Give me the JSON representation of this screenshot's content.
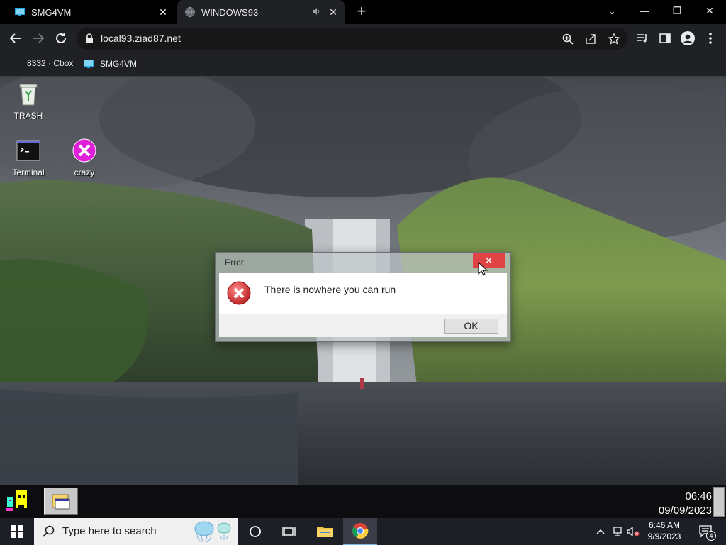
{
  "browser": {
    "tabs": [
      {
        "title": "SMG4VM",
        "active": false
      },
      {
        "title": "WINDOWS93",
        "active": true
      }
    ],
    "url": "local93.ziad87.net",
    "bookmarks": [
      {
        "label": "8332 · Cbox"
      },
      {
        "label": "SMG4VM"
      }
    ]
  },
  "desktop": {
    "icons": [
      {
        "label": "TRASH",
        "icon": "recycle-bin-icon"
      },
      {
        "label": "Terminal",
        "icon": "terminal-icon"
      },
      {
        "label": "crazy",
        "icon": "crazy-x-icon"
      }
    ]
  },
  "dialog": {
    "title": "Error",
    "message": "There is nowhere you can run",
    "ok_label": "OK",
    "close_color": "#e04343"
  },
  "w93_taskbar": {
    "time": "06:46",
    "date": "09/09/2023"
  },
  "win_taskbar": {
    "search_placeholder": "Type here to search",
    "time": "6:46 AM",
    "date": "9/9/2023",
    "notification_count": "4",
    "accent": "#76b9ed"
  }
}
